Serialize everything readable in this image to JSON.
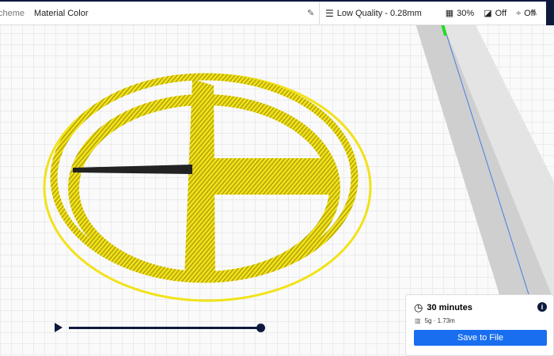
{
  "view_bar": {
    "label": "cheme",
    "value": "Material Color"
  },
  "print_settings": {
    "profile": "Low Quality - 0.28mm",
    "infill": "30%",
    "support": "Off",
    "adhesion": "Off"
  },
  "estimate": {
    "time": "30 minutes",
    "material": "5g · 1.73m",
    "save_label": "Save to File"
  },
  "colors": {
    "accent": "#196ef0",
    "navy": "#0e1a3d",
    "model": "#f2e21a"
  }
}
